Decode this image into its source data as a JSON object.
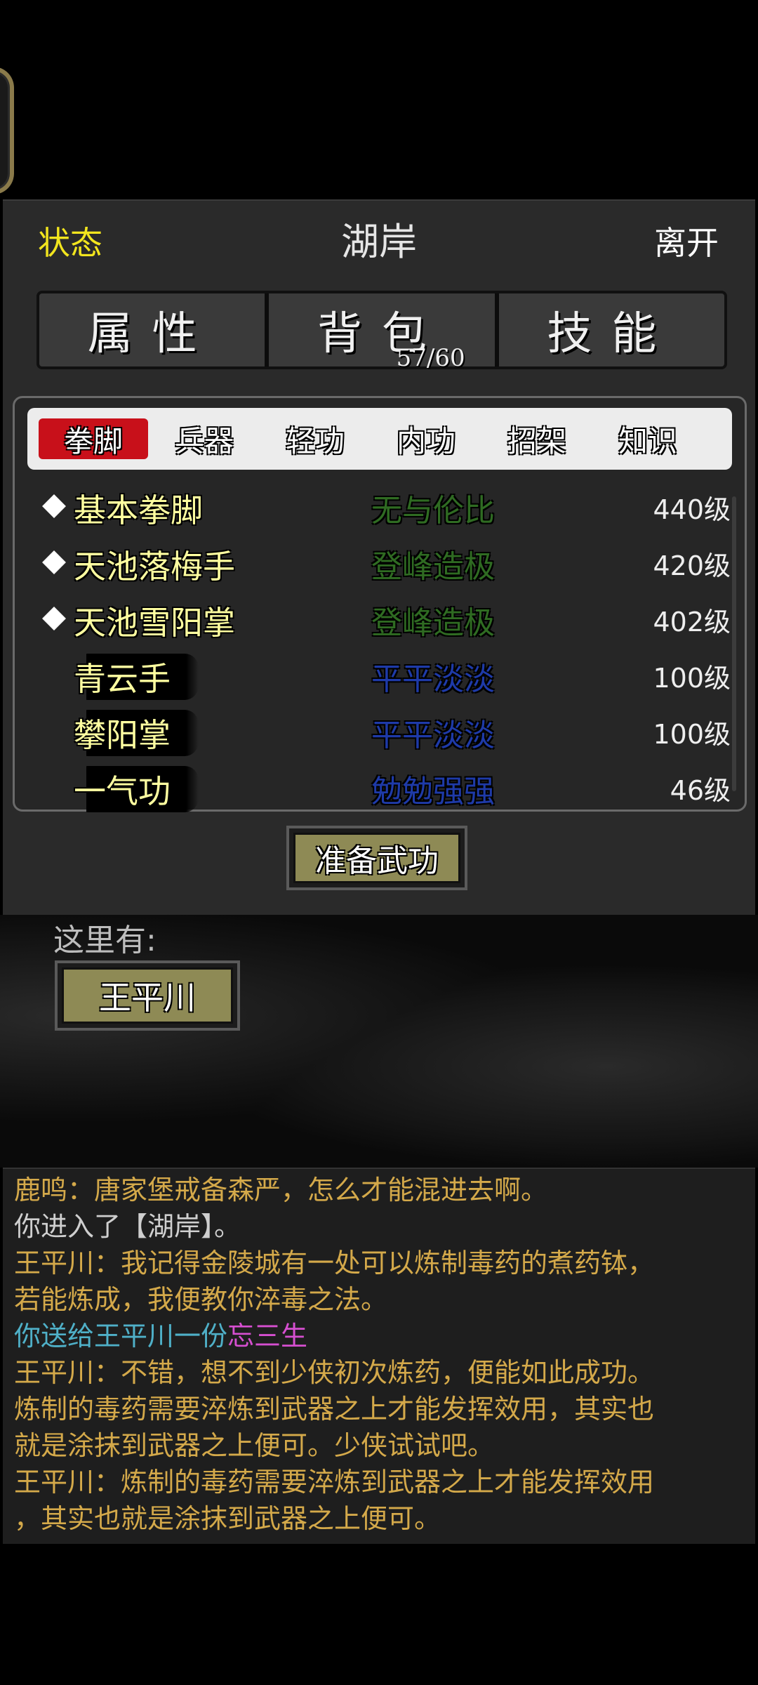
{
  "header": {
    "status_label": "状态",
    "location": "湖岸",
    "leave_label": "离开"
  },
  "main_tabs": [
    {
      "label": "属性"
    },
    {
      "label": "背包",
      "count": "57/60"
    },
    {
      "label": "技能"
    }
  ],
  "categories": [
    "拳脚",
    "兵器",
    "轻功",
    "内功",
    "招架",
    "知识"
  ],
  "active_category": "拳脚",
  "skills": [
    {
      "name": "基本拳脚",
      "grade": "无与伦比",
      "level": "440级",
      "equipped": true,
      "grade_color": "#2f6b22"
    },
    {
      "name": "天池落梅手",
      "grade": "登峰造极",
      "level": "420级",
      "equipped": true,
      "grade_color": "#2f6b22"
    },
    {
      "name": "天池雪阳掌",
      "grade": "登峰造极",
      "level": "402级",
      "equipped": true,
      "grade_color": "#2f6b22"
    },
    {
      "name": "青云手",
      "grade": "平平淡淡",
      "level": "100级",
      "equipped": false,
      "grade_color": "#1e3aa8"
    },
    {
      "name": "攀阳掌",
      "grade": "平平淡淡",
      "level": "100级",
      "equipped": false,
      "grade_color": "#1e3aa8"
    },
    {
      "name": "一气功",
      "grade": "勉勉强强",
      "level": "46级",
      "equipped": false,
      "grade_color": "#1e3aa8"
    }
  ],
  "prepare_button": "准备武功",
  "here": {
    "label": "这里有:",
    "npc": "王平川"
  },
  "log": [
    {
      "parts": [
        {
          "text": "鹿鸣：唐家堡戒备森严，怎么才能混进去啊。",
          "color": "#d4a94a"
        }
      ]
    },
    {
      "parts": [
        {
          "text": "你进入了【湖岸】。",
          "color": "#cfcfcf"
        }
      ]
    },
    {
      "parts": [
        {
          "text": "王平川：我记得金陵城有一处可以炼制毒药的煮药钵，",
          "color": "#d4a94a"
        }
      ]
    },
    {
      "parts": [
        {
          "text": "若能炼成，我便教你淬毒之法。",
          "color": "#d4a94a"
        }
      ]
    },
    {
      "parts": [
        {
          "text": "你送给王平川一份",
          "color": "#4fb0c8"
        },
        {
          "text": "忘三生",
          "color": "#d64fd0"
        }
      ]
    },
    {
      "parts": [
        {
          "text": "王平川：不错，想不到少侠初次炼药，便能如此成功。",
          "color": "#d4a94a"
        }
      ]
    },
    {
      "parts": [
        {
          "text": "炼制的毒药需要淬炼到武器之上才能发挥效用，其实也",
          "color": "#d4a94a"
        }
      ]
    },
    {
      "parts": [
        {
          "text": "就是涂抹到武器之上便可。少侠试试吧。",
          "color": "#d4a94a"
        }
      ]
    },
    {
      "parts": [
        {
          "text": "王平川：炼制的毒药需要淬炼到武器之上才能发挥效用",
          "color": "#d4a94a"
        }
      ]
    },
    {
      "parts": [
        {
          "text": "，其实也就是涂抹到武器之上便可。",
          "color": "#d4a94a"
        }
      ]
    }
  ]
}
